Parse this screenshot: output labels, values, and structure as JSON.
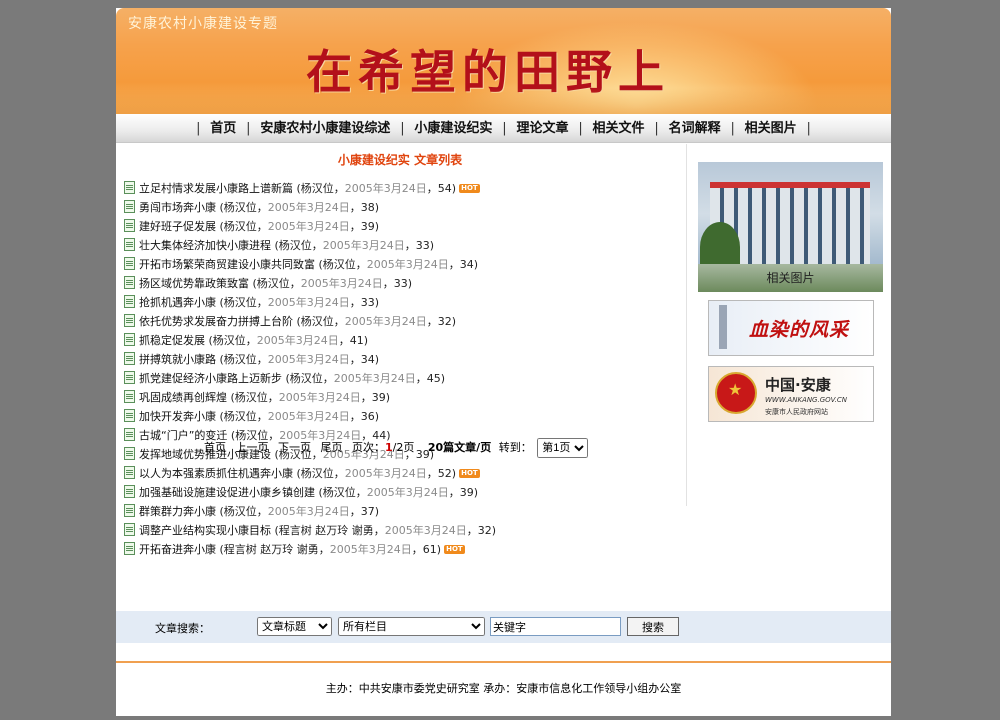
{
  "banner": {
    "subtitle": "安康农村小康建设专题",
    "headline": "在希望的田野上"
  },
  "nav": {
    "items": [
      "首页",
      "安康农村小康建设综述",
      "小康建设纪实",
      "理论文章",
      "相关文件",
      "名词解释",
      "相关图片"
    ]
  },
  "list": {
    "heading": "小康建设纪实  文章列表",
    "articles": [
      {
        "title": "立足村情求发展小康路上谱新篇",
        "author": "杨汉位",
        "date": "2005年3月24日",
        "views": "54",
        "hot": true
      },
      {
        "title": "勇闯市场奔小康",
        "author": "杨汉位",
        "date": "2005年3月24日",
        "views": "38",
        "hot": false
      },
      {
        "title": "建好班子促发展",
        "author": "杨汉位",
        "date": "2005年3月24日",
        "views": "39",
        "hot": false
      },
      {
        "title": "壮大集体经济加快小康进程",
        "author": "杨汉位",
        "date": "2005年3月24日",
        "views": "33",
        "hot": false
      },
      {
        "title": "开拓市场繁荣商贸建设小康共同致富",
        "author": "杨汉位",
        "date": "2005年3月24日",
        "views": "34",
        "hot": false
      },
      {
        "title": "扬区域优势靠政策致富",
        "author": "杨汉位",
        "date": "2005年3月24日",
        "views": "33",
        "hot": false
      },
      {
        "title": "抢抓机遇奔小康",
        "author": "杨汉位",
        "date": "2005年3月24日",
        "views": "33",
        "hot": false
      },
      {
        "title": "依托优势求发展奋力拼搏上台阶",
        "author": "杨汉位",
        "date": "2005年3月24日",
        "views": "32",
        "hot": false
      },
      {
        "title": "抓稳定促发展",
        "author": "杨汉位",
        "date": "2005年3月24日",
        "views": "41",
        "hot": false
      },
      {
        "title": "拼搏筑就小康路",
        "author": "杨汉位",
        "date": "2005年3月24日",
        "views": "34",
        "hot": false
      },
      {
        "title": "抓党建促经济小康路上迈新步",
        "author": "杨汉位",
        "date": "2005年3月24日",
        "views": "45",
        "hot": false
      },
      {
        "title": "巩固成绩再创辉煌",
        "author": "杨汉位",
        "date": "2005年3月24日",
        "views": "39",
        "hot": false
      },
      {
        "title": "加快开发奔小康",
        "author": "杨汉位",
        "date": "2005年3月24日",
        "views": "36",
        "hot": false
      },
      {
        "title": "古城“门户”的变迁",
        "author": "杨汉位",
        "date": "2005年3月24日",
        "views": "44",
        "hot": false
      },
      {
        "title": "发挥地域优势推进小康建设",
        "author": "杨汉位",
        "date": "2005年3月24日",
        "views": "39",
        "hot": false
      },
      {
        "title": "以人为本强素质抓住机遇奔小康",
        "author": "杨汉位",
        "date": "2005年3月24日",
        "views": "52",
        "hot": true
      },
      {
        "title": "加强基础设施建设促进小康乡镇创建",
        "author": "杨汉位",
        "date": "2005年3月24日",
        "views": "39",
        "hot": false
      },
      {
        "title": "群策群力奔小康",
        "author": "杨汉位",
        "date": "2005年3月24日",
        "views": "37",
        "hot": false
      },
      {
        "title": "调整产业结构实现小康目标",
        "author": "程言树 赵万玲 谢勇",
        "date": "2005年3月24日",
        "views": "32",
        "hot": false
      },
      {
        "title": "开拓奋进奔小康",
        "author": "程言树 赵万玲 谢勇",
        "date": "2005年3月24日",
        "views": "61",
        "hot": true
      }
    ],
    "hot_label": "HOT"
  },
  "sidebar": {
    "photo_caption": "相关图片",
    "ad1_text": "血染的风采",
    "ad2_title": "中国·安康",
    "ad2_url": "WWW.ANKANG.GOV.CN",
    "ad2_name": "安康市人民政府网站"
  },
  "pager": {
    "first": "首页",
    "prev": "上一页",
    "next": "下一页",
    "last": "尾页",
    "page_label": "页次：",
    "current": "1",
    "total": "/2页",
    "per_page": "20篇文章/页",
    "goto": "转到：",
    "goto_value": "第1页"
  },
  "search": {
    "label": "文章搜索：",
    "field_value": "文章标题",
    "column_value": "所有栏目",
    "keyword_value": "关键字",
    "button": "搜索"
  },
  "footer": {
    "text": "主办：中共安康市委党史研究室   承办：安康市信息化工作领导小组办公室"
  },
  "colors": {
    "accent": "#e0440e",
    "headline": "#b3101a",
    "hot": "#f08a1c"
  }
}
